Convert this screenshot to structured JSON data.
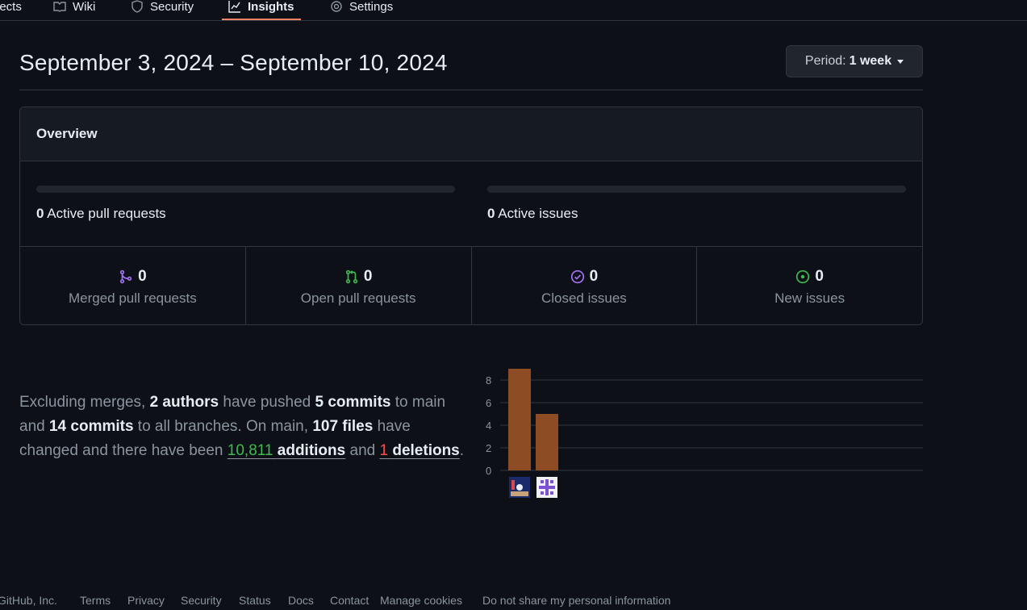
{
  "nav": {
    "tabs": [
      {
        "label": "jects"
      },
      {
        "label": "Wiki"
      },
      {
        "label": "Security"
      },
      {
        "label": "Insights",
        "active": true
      },
      {
        "label": "Settings"
      }
    ]
  },
  "header": {
    "range": "September 3, 2024 – September 10, 2024",
    "period_prefix": "Period:",
    "period_value": "1 week"
  },
  "overview": {
    "title": "Overview",
    "active_prs_count": "0",
    "active_prs_label": "Active pull requests",
    "active_issues_count": "0",
    "active_issues_label": "Active issues",
    "active_prs_fraction": 0,
    "active_issues_fraction": 0,
    "stats": [
      {
        "value": "0",
        "label": "Merged pull requests",
        "icon": "merged-pr-icon",
        "color": "#a371f7"
      },
      {
        "value": "0",
        "label": "Open pull requests",
        "icon": "open-pr-icon",
        "color": "#3fb950"
      },
      {
        "value": "0",
        "label": "Closed issues",
        "icon": "closed-issue-icon",
        "color": "#a371f7"
      },
      {
        "value": "0",
        "label": "New issues",
        "icon": "new-issue-icon",
        "color": "#3fb950"
      }
    ]
  },
  "summary": {
    "p1": "Excluding merges, ",
    "authors": "2 authors",
    "p2": " have pushed ",
    "commits_main": "5 commits",
    "p3": " to main and ",
    "commits_all": "14 commits",
    "p4": " to all branches. On main, ",
    "files": "107 files",
    "p5": " have changed and there have been ",
    "additions_num": "10,811",
    "additions_word": "additions",
    "p6": " and ",
    "deletions_num": "1",
    "deletions_word": "deletions",
    "p7": "."
  },
  "chart_data": {
    "type": "bar",
    "categories": [
      "author-1",
      "author-2"
    ],
    "values": [
      9,
      5
    ],
    "ylim": [
      0,
      8
    ],
    "yticks": [
      "0",
      "2",
      "4",
      "6",
      "8"
    ],
    "grid": true,
    "bar_color": "#8d4c23"
  },
  "footer": {
    "items": [
      "GitHub, Inc.",
      "Terms",
      "Privacy",
      "Security",
      "Status",
      "Docs",
      "Contact",
      "Manage cookies",
      "Do not share my personal information"
    ]
  }
}
